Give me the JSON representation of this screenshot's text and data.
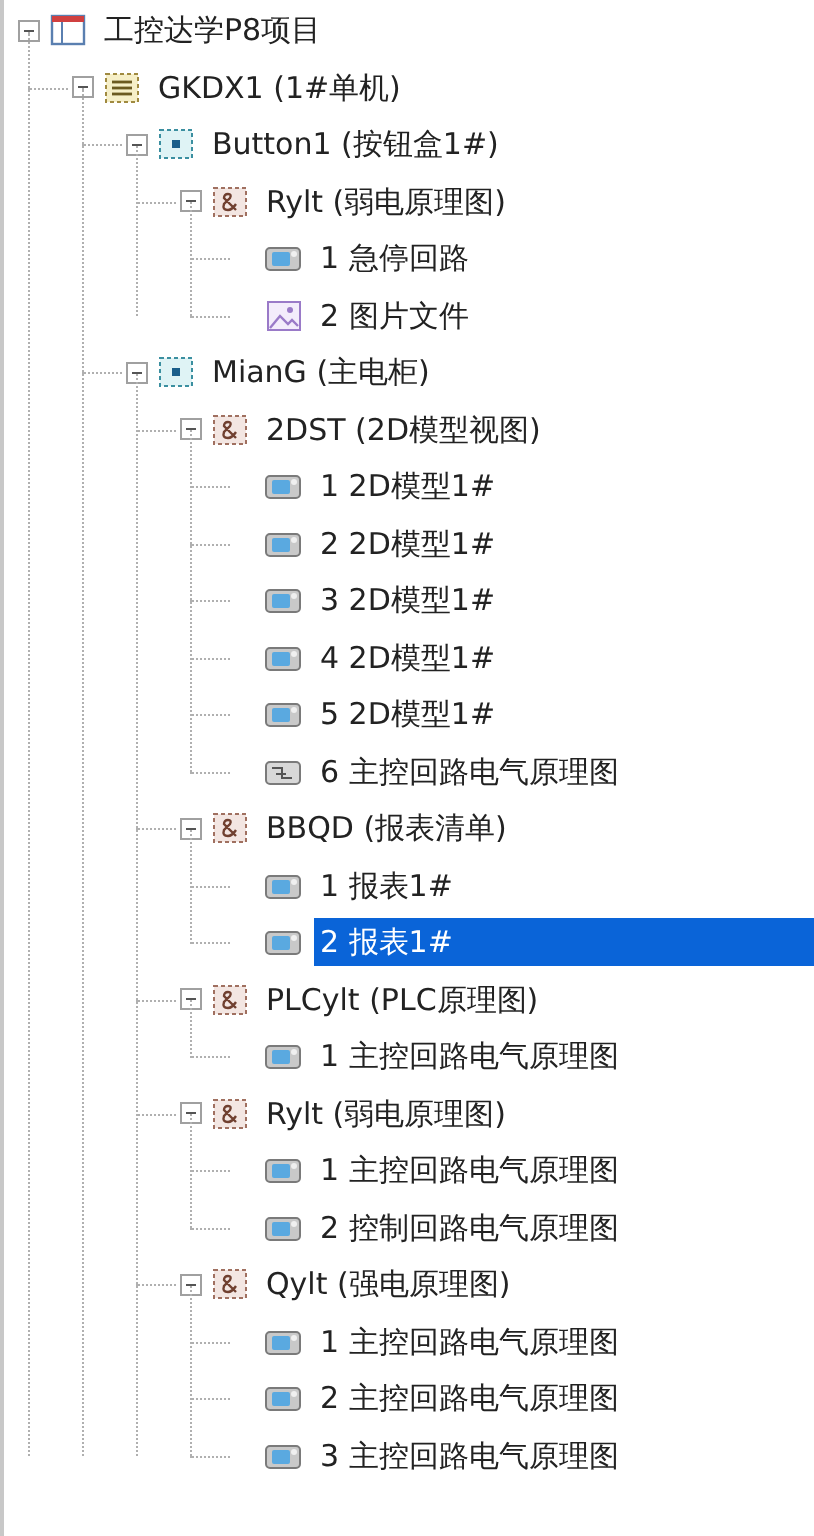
{
  "tree": [
    {
      "kind": "project",
      "label": "工控达学P8项目",
      "expanded": true,
      "selected": false,
      "children": [
        {
          "kind": "unit",
          "label": "GKDX1 (1#单机)",
          "expanded": true,
          "selected": false,
          "children": [
            {
              "kind": "cabinet",
              "label": "Button1 (按钮盒1#)",
              "expanded": true,
              "selected": false,
              "children": [
                {
                  "kind": "group",
                  "label": "Rylt (弱电原理图)",
                  "expanded": true,
                  "selected": false,
                  "children": [
                    {
                      "kind": "page",
                      "label": "1 急停回路",
                      "selected": false
                    },
                    {
                      "kind": "image",
                      "label": "2 图片文件",
                      "selected": false
                    }
                  ]
                }
              ]
            },
            {
              "kind": "cabinet",
              "label": "MianG (主电柜)",
              "expanded": true,
              "selected": false,
              "children": [
                {
                  "kind": "group",
                  "label": "2DST (2D模型视图)",
                  "expanded": true,
                  "selected": false,
                  "children": [
                    {
                      "kind": "page",
                      "label": "1 2D模型1#",
                      "selected": false
                    },
                    {
                      "kind": "page",
                      "label": "2 2D模型1#",
                      "selected": false
                    },
                    {
                      "kind": "page",
                      "label": "3 2D模型1#",
                      "selected": false
                    },
                    {
                      "kind": "page",
                      "label": "4 2D模型1#",
                      "selected": false
                    },
                    {
                      "kind": "page",
                      "label": "5 2D模型1#",
                      "selected": false
                    },
                    {
                      "kind": "drawing",
                      "label": "6 主控回路电气原理图",
                      "selected": false
                    }
                  ]
                },
                {
                  "kind": "group",
                  "label": "BBQD (报表清单)",
                  "expanded": true,
                  "selected": false,
                  "children": [
                    {
                      "kind": "page",
                      "label": "1 报表1#",
                      "selected": false
                    },
                    {
                      "kind": "page",
                      "label": "2 报表1#",
                      "selected": true
                    }
                  ]
                },
                {
                  "kind": "group",
                  "label": "PLCylt (PLC原理图)",
                  "expanded": true,
                  "selected": false,
                  "children": [
                    {
                      "kind": "page",
                      "label": "1 主控回路电气原理图",
                      "selected": false
                    }
                  ]
                },
                {
                  "kind": "group",
                  "label": "Rylt (弱电原理图)",
                  "expanded": true,
                  "selected": false,
                  "children": [
                    {
                      "kind": "page",
                      "label": "1 主控回路电气原理图",
                      "selected": false
                    },
                    {
                      "kind": "page",
                      "label": "2 控制回路电气原理图",
                      "selected": false
                    }
                  ]
                },
                {
                  "kind": "group",
                  "label": "Qylt (强电原理图)",
                  "expanded": true,
                  "selected": false,
                  "children": [
                    {
                      "kind": "page",
                      "label": "1 主控回路电气原理图",
                      "selected": false
                    },
                    {
                      "kind": "page",
                      "label": "2 主控回路电气原理图",
                      "selected": false
                    },
                    {
                      "kind": "page",
                      "label": "3 主控回路电气原理图",
                      "selected": false
                    }
                  ]
                }
              ]
            }
          ]
        }
      ]
    }
  ]
}
